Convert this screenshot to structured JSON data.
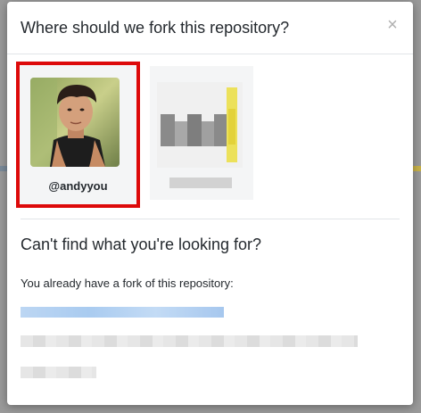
{
  "modal": {
    "title": "Where should we fork this repository?",
    "close_icon": "close-icon",
    "close_glyph": "×"
  },
  "owners": [
    {
      "name": "@andyyou",
      "selected": true
    },
    {
      "name": "",
      "selected": false
    }
  ],
  "help": {
    "title": "Can't find what you're looking for?",
    "note": "You already have a fork of this repository:"
  },
  "colors": {
    "selection_border": "#dd0a0a",
    "card_background": "#f4f5f6",
    "link_blue": "#0366d6"
  }
}
